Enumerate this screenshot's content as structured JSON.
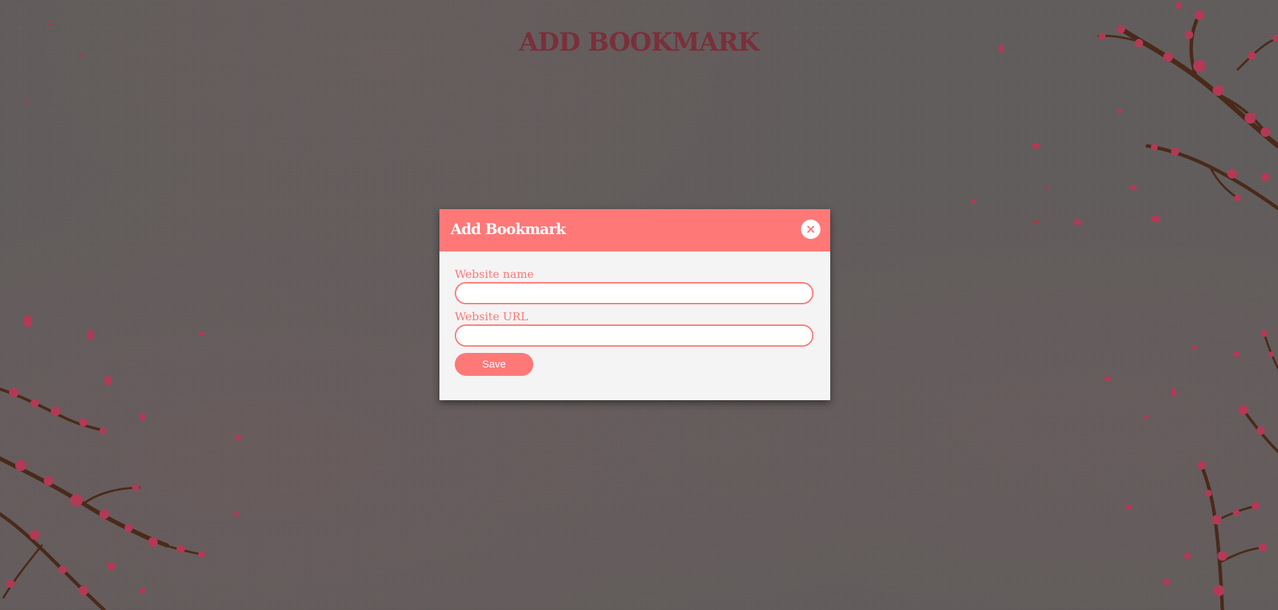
{
  "page": {
    "title": "ADD BOOKMARK"
  },
  "modal": {
    "title": "Add Bookmark",
    "close_icon": "close-icon",
    "fields": [
      {
        "label": "Website name",
        "value": "",
        "placeholder": ""
      },
      {
        "label": "Website URL",
        "value": "",
        "placeholder": ""
      }
    ],
    "save_label": "Save"
  },
  "colors": {
    "background": "#615d5c",
    "accent": "#ff7878",
    "title": "#7a2f3a",
    "modal_body": "#f4f4f4",
    "branch": "#4a2a1a",
    "blossom": "#b23a56"
  }
}
